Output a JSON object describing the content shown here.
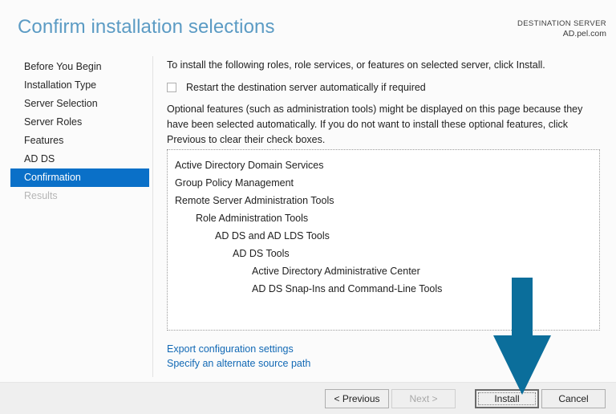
{
  "header": {
    "title": "Confirm installation selections",
    "destination_label": "DESTINATION SERVER",
    "destination_value": "AD.pel.com"
  },
  "sidebar": {
    "items": [
      {
        "label": "Before You Begin",
        "state": "normal"
      },
      {
        "label": "Installation Type",
        "state": "normal"
      },
      {
        "label": "Server Selection",
        "state": "normal"
      },
      {
        "label": "Server Roles",
        "state": "normal"
      },
      {
        "label": "Features",
        "state": "normal"
      },
      {
        "label": "AD DS",
        "state": "normal"
      },
      {
        "label": "Confirmation",
        "state": "selected"
      },
      {
        "label": "Results",
        "state": "disabled"
      }
    ]
  },
  "main": {
    "intro_text": "To install the following roles, role services, or features on selected server, click Install.",
    "restart_checkbox_label": "Restart the destination server automatically if required",
    "restart_checkbox_checked": false,
    "note_text": "Optional features (such as administration tools) might be displayed on this page because they have been selected automatically. If you do not want to install these optional features, click Previous to clear their check boxes.",
    "selection_list": [
      {
        "label": "Active Directory Domain Services",
        "indent": 0
      },
      {
        "label": "Group Policy Management",
        "indent": 0
      },
      {
        "label": "Remote Server Administration Tools",
        "indent": 0
      },
      {
        "label": "Role Administration Tools",
        "indent": 1
      },
      {
        "label": "AD DS and AD LDS Tools",
        "indent": 2
      },
      {
        "label": "AD DS Tools",
        "indent": 3
      },
      {
        "label": "Active Directory Administrative Center",
        "indent": 4
      },
      {
        "label": "AD DS Snap-Ins and Command-Line Tools",
        "indent": 4
      }
    ],
    "links": [
      {
        "label": "Export configuration settings"
      },
      {
        "label": "Specify an alternate source path"
      }
    ]
  },
  "footer": {
    "previous_label": "< Previous",
    "next_label": "Next >",
    "install_label": "Install",
    "cancel_label": "Cancel",
    "next_disabled": true,
    "install_focused": true
  },
  "annotation": {
    "type": "down-arrow",
    "points_to": "Install",
    "color": "#0b6e9b"
  },
  "colors": {
    "title": "#5b9bc4",
    "selection": "#0a70c8",
    "link": "#1269b5",
    "arrow": "#0b6e9b",
    "footer_bg": "#efefef",
    "page_bg": "#fbfbfb"
  }
}
